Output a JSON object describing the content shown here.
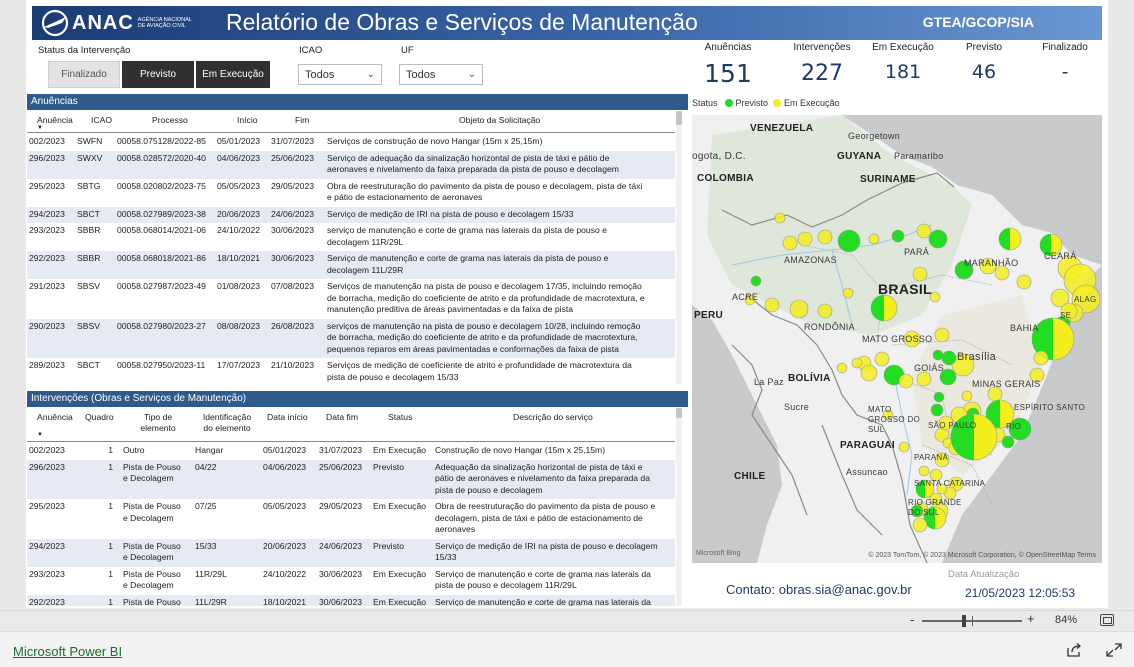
{
  "header": {
    "logo_text": "ANAC",
    "logo_sub": "Agência Nacional de Aviação Civil",
    "title": "Relatório de Obras e Serviços de Manutenção",
    "org": "GTEA/GCOP/SIA"
  },
  "filters": {
    "status_label": "Status da Intervenção",
    "status_options": [
      "Finalizado",
      "Previsto",
      "Em Execução"
    ],
    "icao_label": "ICAO",
    "icao_value": "Todos",
    "uf_label": "UF",
    "uf_value": "Todos"
  },
  "kpis": [
    {
      "label": "Anuências",
      "value": "151"
    },
    {
      "label": "Intervenções",
      "value": "227"
    },
    {
      "label": "Em Execução",
      "value": "181"
    },
    {
      "label": "Previsto",
      "value": "46"
    },
    {
      "label": "Finalizado",
      "value": "-"
    }
  ],
  "anuencias": {
    "title": "Anuências",
    "columns": [
      "Anuência",
      "ICAO",
      "Processo",
      "Início",
      "Fim",
      "Objeto da Solicitação"
    ],
    "rows": [
      [
        "002/2023",
        "SWFN",
        "00058.075128/2022-85",
        "05/01/2023",
        "31/07/2023",
        [
          "Serviços de construção de novo Hangar (15m x 25,15m)"
        ]
      ],
      [
        "296/2023",
        "SWXV",
        "00058.028572/2020-40",
        "04/06/2023",
        "25/06/2023",
        [
          "Serviço de adequação da sinalização horizontal de pista de táxi e pátio de",
          "aeronaves e nivelamento da faixa preparada da pista de pouso e decolagem"
        ]
      ],
      [
        "295/2023",
        "SBTG",
        "00058.020802/2023-75",
        "05/05/2023",
        "29/05/2023",
        [
          "Obra de reestruturação do pavimento da pista de pouso e decolagem, pista de táxi",
          "e pátio de estacionamento de aeronaves"
        ]
      ],
      [
        "294/2023",
        "SBCT",
        "00058.027989/2023-38",
        "20/06/2023",
        "24/06/2023",
        [
          "Serviço de medição de IRI na pista de pouso e decolagem 15/33"
        ]
      ],
      [
        "293/2023",
        "SBBR",
        "00058.068014/2021-06",
        "24/10/2022",
        "30/06/2023",
        [
          "serviço de manutenção e corte de grama nas laterais da pista de pouso e",
          "decolagem 11R/29L"
        ]
      ],
      [
        "292/2023",
        "SBBR",
        "00058.068018/2021-86",
        "18/10/2021",
        "30/06/2023",
        [
          "Serviço de manutenção e corte de grama nas laterais da pista de pouso e",
          "decolagem 11L/29R"
        ]
      ],
      [
        "291/2023",
        "SBSV",
        "00058.027987/2023-49",
        "01/08/2023",
        "07/08/2023",
        [
          "Serviços de manutenção na pista de pouso e decolagem 17/35, incluindo remoção",
          "de borracha, medição do coeficiente de atrito e da profundidade de macrotextura, e",
          "manutenção preditiva de áreas pavimentadas e da faixa de pista"
        ]
      ],
      [
        "290/2023",
        "SBSV",
        "00058.027980/2023-27",
        "08/08/2023",
        "26/08/2023",
        [
          "serviços de manutenção na pista de pouso e decolagem 10/28, incluindo remoção",
          "de borracha, medição do coeficiente de atrito e da profundidade de macrotextura,",
          "pequenos reparos em áreas pavimentadas e conformações da faixa de pista"
        ]
      ],
      [
        "289/2023",
        "SBCT",
        "00058.027950/2023-11",
        "17/07/2023",
        "21/10/2023",
        [
          "Serviços de medição de coeficiente de atrito e profundidade de macrotextura da",
          "pista de pouso e decolagem 15/33"
        ]
      ]
    ]
  },
  "intervencoes": {
    "title": "Intervenções (Obras e Serviços de Manutenção)",
    "columns": [
      "Anuência",
      "Quadro",
      "Tipo de elemento",
      "Identificação do elemento",
      "Data início",
      "Data fim",
      "Status",
      "Descrição do serviço"
    ],
    "rows": [
      [
        "002/2023",
        "1",
        [
          "Outro"
        ],
        "Hangar",
        "05/01/2023",
        "31/07/2023",
        "Em Execução",
        [
          "Construção de novo Hangar (15m x 25,15m)"
        ]
      ],
      [
        "296/2023",
        "1",
        [
          "Pista de Pouso",
          "e Decolagem"
        ],
        "04/22",
        "04/06/2023",
        "25/06/2023",
        "Previsto",
        [
          "Adequação da sinalização horizontal de pista de táxi e",
          "pátio de aeronaves e nivelamento da faixa preparada da",
          "pista de pouso e decolagem"
        ]
      ],
      [
        "295/2023",
        "1",
        [
          "Pista de Pouso",
          "e Decolagem"
        ],
        "07/25",
        "05/05/2023",
        "29/05/2023",
        "Em Execução",
        [
          "Obra de reestruturação do pavimento da pista de pouso e",
          "decolagem, pista de táxi e pátio de estacionamento de",
          "aeronaves"
        ]
      ],
      [
        "294/2023",
        "1",
        [
          "Pista de Pouso",
          "e Decolagem"
        ],
        "15/33",
        "20/06/2023",
        "24/06/2023",
        "Previsto",
        [
          "Serviço de medição de IRI na pista de pouso e decolagem",
          "15/33"
        ]
      ],
      [
        "293/2023",
        "1",
        [
          "Pista de Pouso",
          "e Decolagem"
        ],
        "11R/29L",
        "24/10/2022",
        "30/06/2023",
        "Em Execução",
        [
          "Serviço de manutenção e corte de grama nas laterais da",
          "pista de pouso e decolagem 11R/29L"
        ]
      ],
      [
        "292/2023",
        "1",
        [
          "Pista de Pouso"
        ],
        "11L/29R",
        "18/10/2021",
        "30/06/2023",
        "Em Execução",
        [
          "Serviço de manutenção e corte de grama nas laterais da"
        ]
      ]
    ]
  },
  "map": {
    "status_label": "Status",
    "legend": [
      {
        "label": "Previsto",
        "color": "#22dd22"
      },
      {
        "label": "Em Execução",
        "color": "#f5ee1e"
      }
    ],
    "labels": {
      "venezuela": "VENEZUELA",
      "georgetown": "Georgetown",
      "bogota": "ogota, D.C.",
      "guyana": "GUYANA",
      "paramaribo": "Paramaribo",
      "colombia": "COLOMBIA",
      "suriname": "SURINAME",
      "amazonas": "AMAZONAS",
      "para": "PARÁ",
      "maranhao": "MARANHÃO",
      "ceara": "CEARÁ",
      "brasil": "BRASIL",
      "acre": "ACRE",
      "peru": "PERU",
      "rondonia": "RONDÔNIA",
      "bahia": "BAHIA",
      "matogrosso": "MATO GROSSO",
      "brasilia": "Brasília",
      "lapaz": "La Paz",
      "bolivia": "BOLÍVIA",
      "goias": "GOIÁS",
      "minas": "MINAS GERAIS",
      "sucre": "Sucre",
      "mtsul": "MATO GROSSO DO SUL",
      "espirito": "ESPÍRITO SANTO",
      "saopaulo": "SÃO PAULO",
      "paraguai": "PARAGUAI",
      "assuncao": "Assuncao",
      "parana": "PARANÁ",
      "chile": "CHILE",
      "santacatarina": "SANTA CATARINA",
      "riogrande": "RIO GRANDE DO SUL",
      "rio": "RIO",
      "ale": "ALAG",
      "se": "SE"
    },
    "bing": "Microsoft Bing",
    "attribution": "© 2023 TomTom, © 2023 Microsoft Corporation, © OpenStreetMap Terms"
  },
  "contact": "Contato: obras.sia@anac.gov.br",
  "update": {
    "label": "Data Atualização",
    "value": "21/05/2023 12:05:53"
  },
  "zoom": {
    "minus": "-",
    "plus": "+",
    "percent": "84%",
    "level": 0.42
  },
  "footer": {
    "link": "Microsoft Power BI"
  }
}
